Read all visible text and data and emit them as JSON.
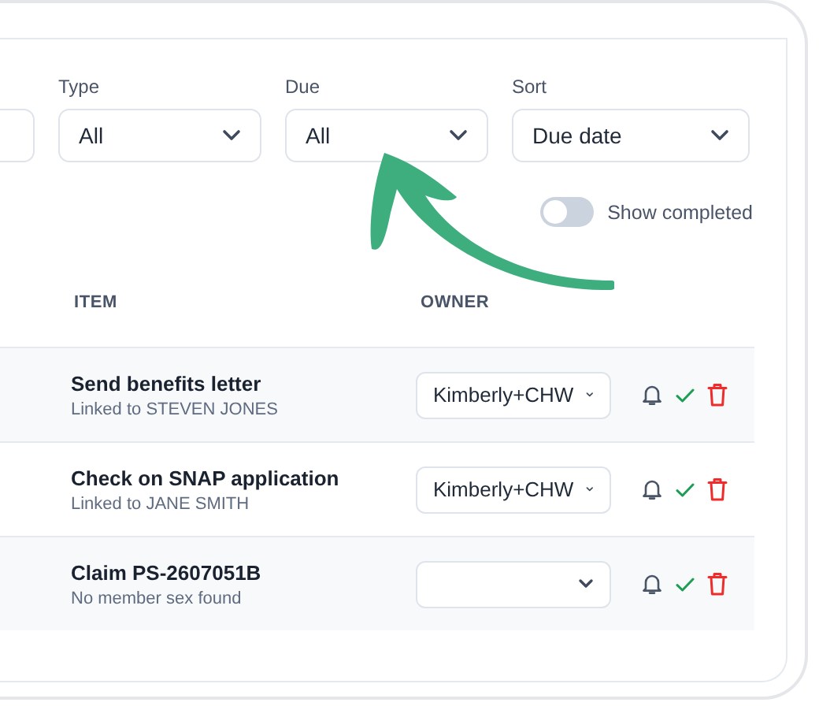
{
  "filters": [
    {
      "kind": "cut"
    },
    {
      "kind": "select",
      "label": "Type",
      "value": "All"
    },
    {
      "kind": "select",
      "label": "Due",
      "value": "All"
    },
    {
      "kind": "select",
      "label": "Sort",
      "value": "Due date"
    }
  ],
  "show_completed": {
    "label": "Show completed",
    "on": false
  },
  "table": {
    "columns": [
      "ITEM",
      "OWNER"
    ],
    "rows": [
      {
        "title": "Send benefits letter",
        "subtitle": "Linked to STEVEN JONES",
        "owner": "Kimberly+CHW"
      },
      {
        "title": "Check on SNAP application",
        "subtitle": "Linked to JANE SMITH",
        "owner": "Kimberly+CHW"
      },
      {
        "title": "Claim PS-2607051B",
        "subtitle": "No member sex found"
      }
    ]
  }
}
